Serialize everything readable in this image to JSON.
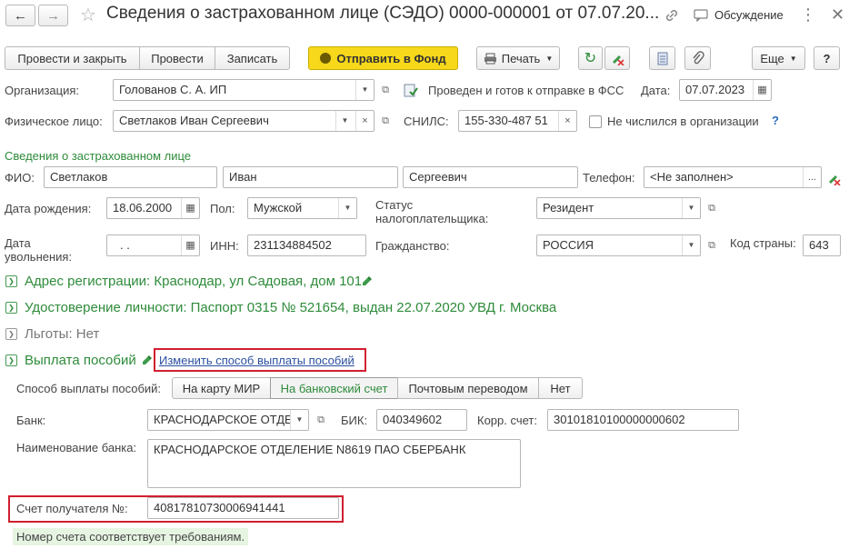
{
  "window": {
    "title": "Сведения о застрахованном лице (СЭДО) 0000-000001 от 07.07.20...",
    "discussion_label": "Обсуждение"
  },
  "toolbar": {
    "post_close": "Провести и закрыть",
    "post": "Провести",
    "save": "Записать",
    "send": "Отправить в Фонд",
    "print": "Печать",
    "more": "Еще",
    "help": "?"
  },
  "header": {
    "org_label": "Организация:",
    "org_value": "Голованов С. А. ИП",
    "status_text": "Проведен и готов к отправке в ФСС",
    "date_label": "Дата:",
    "date_value": "07.07.2023",
    "person_label": "Физическое лицо:",
    "person_value": "Светлаков Иван Сергеевич",
    "snils_label": "СНИЛС:",
    "snils_value": "155-330-487 51",
    "not_listed_label": "Не числился в организации",
    "help_q": "?"
  },
  "insured": {
    "section_title": "Сведения о застрахованном лице",
    "fio_label": "ФИО:",
    "last_name": "Светлаков",
    "first_name": "Иван",
    "middle_name": "Сергеевич",
    "phone_label": "Телефон:",
    "phone_value": "<Не заполнен>",
    "phone_more": "...",
    "birth_label": "Дата рождения:",
    "birth_value": "18.06.2000",
    "gender_label": "Пол:",
    "gender_value": "Мужской",
    "tax_status_label": "Статус налогоплательщика:",
    "tax_status_value": "Резидент",
    "dismissal_label": "Дата увольнения:",
    "dismissal_value": " .  .",
    "inn_label": "ИНН:",
    "inn_value": "231134884502",
    "citizenship_label": "Гражданство:",
    "citizenship_value": "РОССИЯ",
    "country_code_label": "Код страны:",
    "country_code_value": "643"
  },
  "sections": {
    "address": "Адрес регистрации: Краснодар, ул Садовая, дом 101",
    "id_doc": "Удостоверение личности: Паспорт 0315 № 521654, выдан 22.07.2020 УВД г. Москва",
    "benefits": "Льготы: Нет",
    "payments": "Выплата пособий",
    "change_link": "Изменить способ выплаты пособий"
  },
  "payment": {
    "method_label": "Способ выплаты пособий:",
    "methods": [
      "На карту МИР",
      "На банковский счет",
      "Почтовым переводом",
      "Нет"
    ],
    "bank_label": "Банк:",
    "bank_value": "КРАСНОДАРСКОЕ ОТДЕЛЕНИЕ",
    "bik_label": "БИК:",
    "bik_value": "040349602",
    "corr_label": "Корр. счет:",
    "corr_value": "30101810100000000602",
    "bank_name_label": "Наименование банка:",
    "bank_name_value": "КРАСНОДАРСКОЕ ОТДЕЛЕНИЕ N8619 ПАО СБЕРБАНК",
    "account_label": "Счет получателя №:",
    "account_value": "40817810730006941441",
    "account_ok": "Номер счета соответствует требованиям."
  },
  "colors": {
    "accent_green": "#2e8b3a",
    "send_button": "#f7d81a",
    "highlight_red": "#d01f2f",
    "link": "#2a4fa0"
  }
}
